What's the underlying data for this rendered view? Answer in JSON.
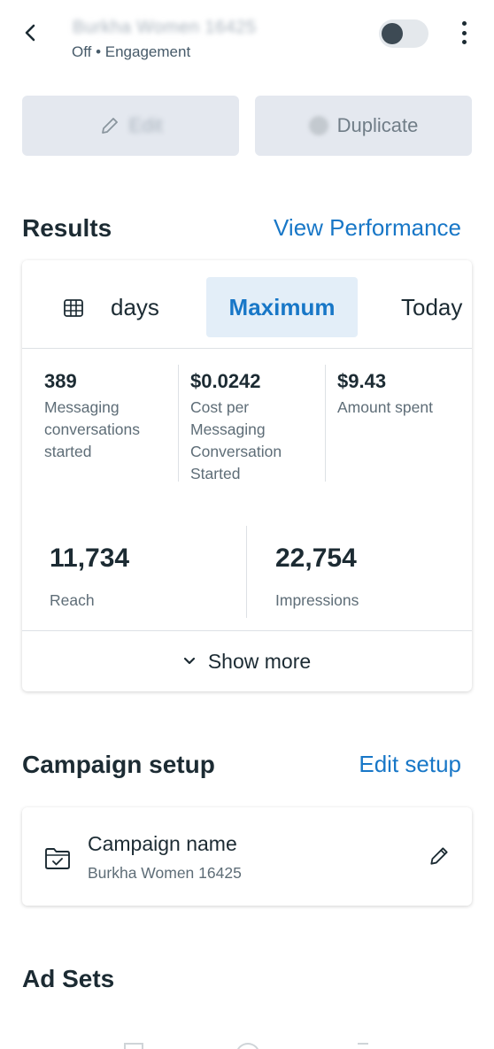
{
  "header": {
    "title": "Burkha Women 16425",
    "subtitle": "Off • Engagement"
  },
  "actions": {
    "edit_label": "Edit",
    "duplicate_label": "Duplicate"
  },
  "results": {
    "heading": "Results",
    "view_link": "View Performance",
    "tabs": [
      "days",
      "Maximum",
      "Today"
    ],
    "selected_tab": "Maximum",
    "metrics": [
      {
        "value": "389",
        "label": "Messaging conversations started"
      },
      {
        "value": "$0.0242",
        "label": "Cost per Messaging Conversation Started"
      },
      {
        "value": "$9.43",
        "label": "Amount spent"
      }
    ],
    "reach": {
      "value": "11,734",
      "label": "Reach"
    },
    "impressions": {
      "value": "22,754",
      "label": "Impressions"
    },
    "show_more": "Show more"
  },
  "campaign_setup": {
    "heading": "Campaign setup",
    "edit_link": "Edit setup",
    "name_label": "Campaign name",
    "name_value": "Burkha Women 16425"
  },
  "ad_sets": {
    "heading": "Ad Sets"
  },
  "colors": {
    "accent": "#1877c7",
    "selected_tab_bg": "#e3eef8",
    "text": "#1c2b33",
    "muted": "#5e6d77"
  }
}
